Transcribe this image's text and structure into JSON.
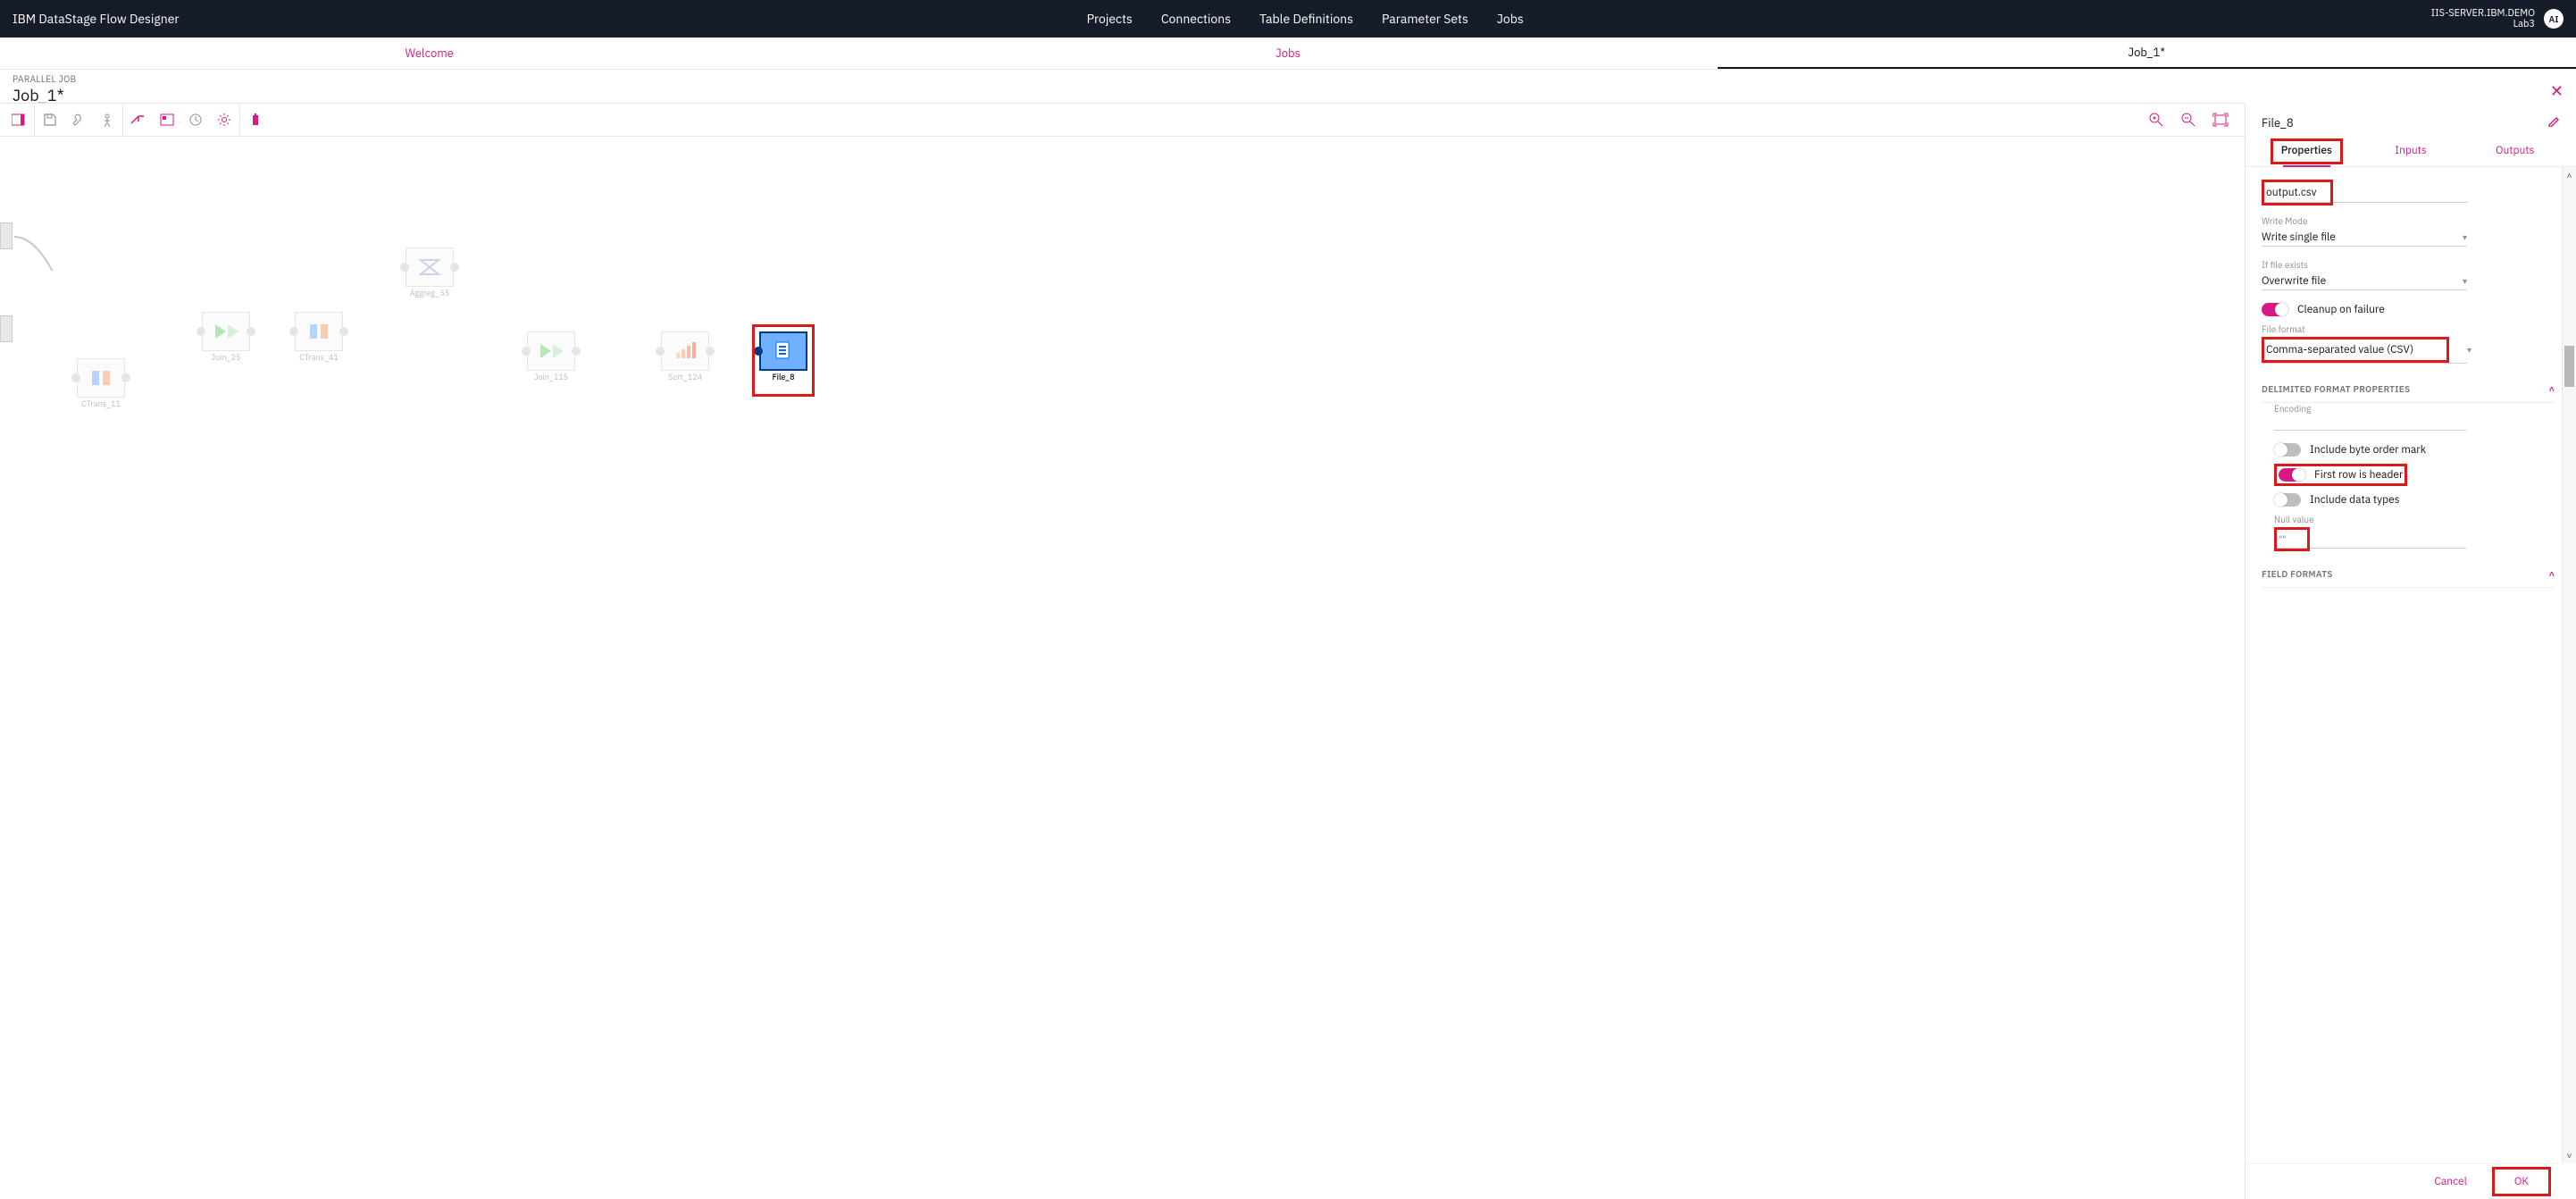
{
  "header": {
    "brand": "IBM DataStage Flow Designer",
    "nav": [
      "Projects",
      "Connections",
      "Table Definitions",
      "Parameter Sets",
      "Jobs"
    ],
    "server": {
      "line1": "IIS-SERVER.IBM.DEMO",
      "line2": "Lab3"
    },
    "avatar": "AI"
  },
  "tabs": {
    "left": "Welcome",
    "mid": "Jobs",
    "right": "Job_1*"
  },
  "title": {
    "crumb": "PARALLEL JOB",
    "name": "Job_1*"
  },
  "nodes": {
    "ctrans11": "CTrans_11",
    "join25": "Join_25",
    "ctrans41": "CTrans_41",
    "aggreg55": "Aggreg_55",
    "join115": "Join_115",
    "sort124": "Sort_124",
    "file8": "File_8"
  },
  "panel": {
    "name": "File_8",
    "tabs": {
      "props": "Properties",
      "inputs": "Inputs",
      "outputs": "Outputs"
    },
    "filename_value": "output.csv",
    "writeMode": {
      "label": "Write Mode",
      "value": "Write single file"
    },
    "ifExists": {
      "label": "If file exists",
      "value": "Overwrite file"
    },
    "cleanup": "Cleanup on failure",
    "fileFormat": {
      "label": "File format",
      "value": "Comma-separated value (CSV)"
    },
    "delimSection": "DELIMITED FORMAT PROPERTIES",
    "encoding": {
      "label": "Encoding",
      "value": ""
    },
    "bom": "Include byte order mark",
    "header": "First row is header",
    "types": "Include data types",
    "nullVal": {
      "label": "Null value",
      "value": "\"\""
    },
    "fieldFormats": "FIELD FORMATS",
    "cancel": "Cancel",
    "ok": "OK"
  }
}
